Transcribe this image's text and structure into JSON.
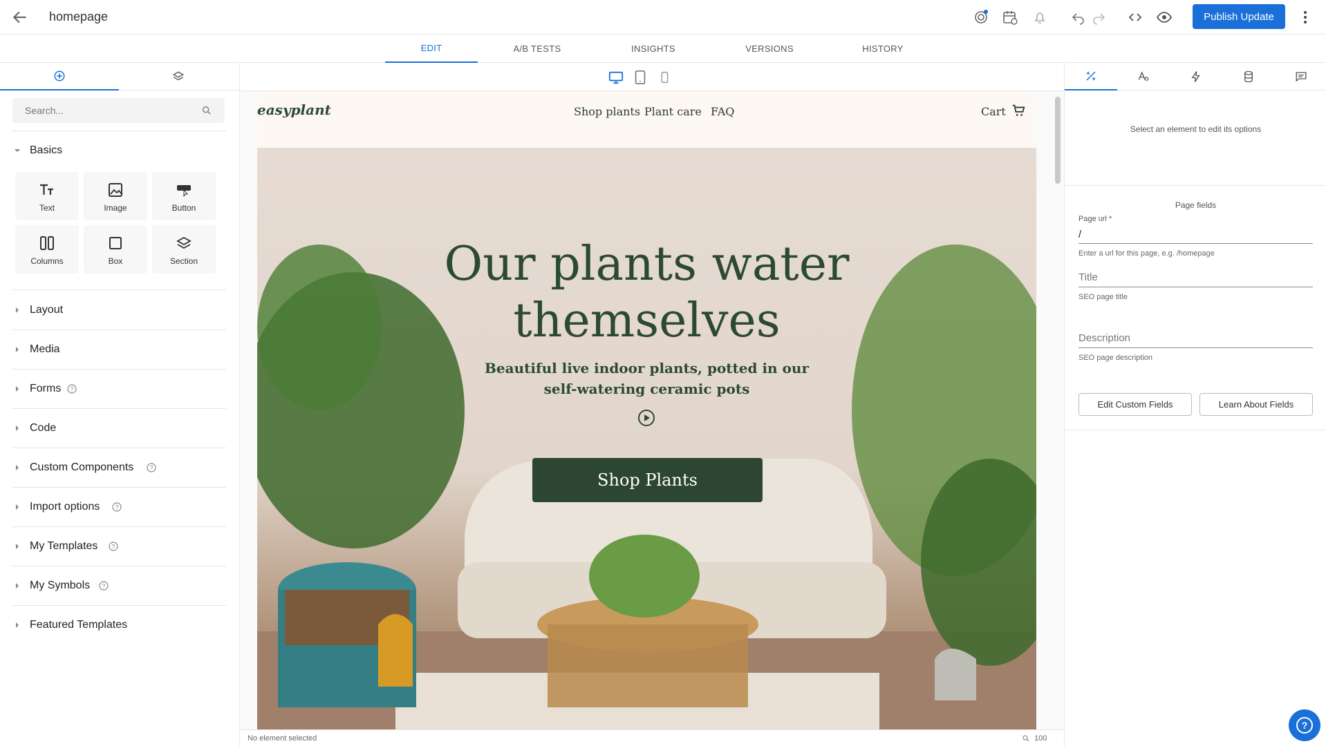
{
  "header": {
    "page_title": "homepage",
    "publish_label": "Publish Update"
  },
  "tabs": [
    {
      "label": "EDIT",
      "active": true
    },
    {
      "label": "A/B TESTS"
    },
    {
      "label": "INSIGHTS"
    },
    {
      "label": "VERSIONS"
    },
    {
      "label": "HISTORY"
    }
  ],
  "left": {
    "search_placeholder": "Search...",
    "basics": {
      "label": "Basics",
      "blocks": [
        "Text",
        "Image",
        "Button",
        "Columns",
        "Box",
        "Section"
      ]
    },
    "sections": [
      {
        "label": "Layout"
      },
      {
        "label": "Media"
      },
      {
        "label": "Forms"
      },
      {
        "label": "Code"
      },
      {
        "label": "Custom Components"
      },
      {
        "label": "Import options"
      },
      {
        "label": "My Templates"
      },
      {
        "label": "My Symbols"
      },
      {
        "label": "Featured Templates"
      }
    ]
  },
  "site": {
    "logo": "easyplant",
    "nav": [
      "Shop plants",
      "Plant care",
      "FAQ"
    ],
    "cart": "Cart",
    "heading_line1": "Our plants water",
    "heading_line2": "themselves",
    "sub_line1": "Beautiful live indoor plants, potted in our",
    "sub_line2": "self-watering ceramic pots",
    "cta": "Shop Plants"
  },
  "status": {
    "text": "No element selected",
    "zoom": "100"
  },
  "right": {
    "hint": "Select an element to edit its options",
    "page_fields": "Page fields",
    "url_label": "Page url *",
    "url_value": "/",
    "url_help": "Enter a url for this page, e.g. /homepage",
    "title_placeholder": "Title",
    "title_help": "SEO page title",
    "desc_placeholder": "Description",
    "desc_help": "SEO page description",
    "edit_btn": "Edit Custom Fields",
    "learn_btn": "Learn About Fields"
  },
  "colors": {
    "accent": "#1a6fd8",
    "brand_green": "#2c4631"
  }
}
